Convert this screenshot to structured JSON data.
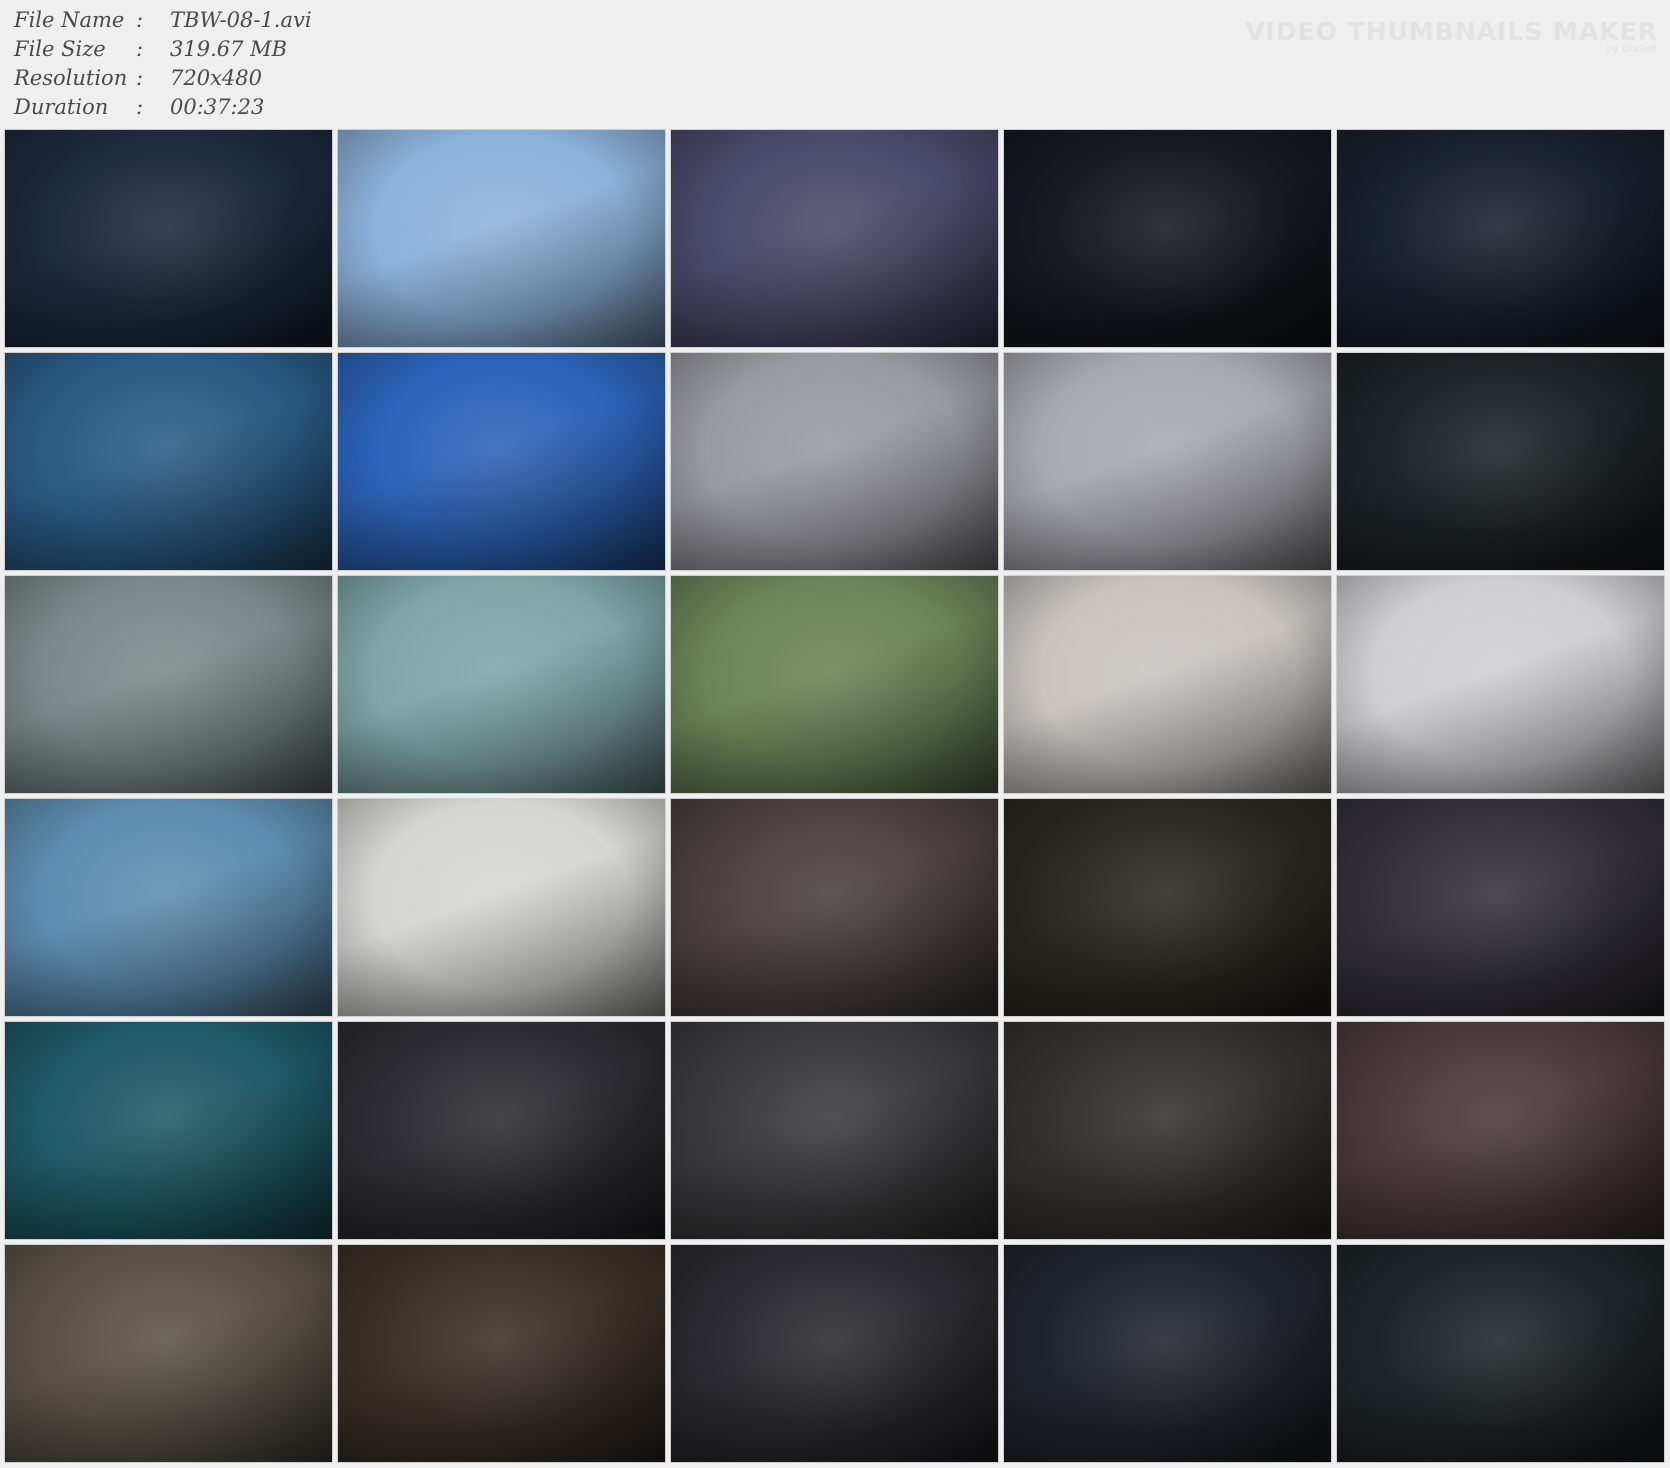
{
  "file_info": {
    "rows": [
      {
        "label": "File Name",
        "value": "TBW-08-1.avi"
      },
      {
        "label": "File Size",
        "value": "319.67 MB"
      },
      {
        "label": "Resolution",
        "value": "720x480"
      },
      {
        "label": "Duration",
        "value": "00:37:23"
      }
    ],
    "separator": ":"
  },
  "watermark": {
    "title": "VIDEO THUMBNAILS MAKER",
    "subtitle": "by DlxSoft"
  },
  "thumbnail_colors": [
    [
      "#1c2a3e",
      "#8cb2da",
      "#4a4a6a",
      "#15181f",
      "#18202c"
    ],
    [
      "#2a5c86",
      "#2c63b8",
      "#9a9aa2",
      "#a8a8b0",
      "#1c2226"
    ],
    [
      "#7a8a8a",
      "#7fa6a8",
      "#6b8458",
      "#c9c4c0",
      "#cfcfd2"
    ],
    [
      "#5d8db0",
      "#d6d6d2",
      "#4a4040",
      "#2a2820",
      "#33303a"
    ],
    [
      "#1e5a66",
      "#2c2c32",
      "#3a3a3c",
      "#34302e",
      "#4a3a3c"
    ],
    [
      "#5a5248",
      "#3a3028",
      "#2a2a30",
      "#20242c",
      "#1e2428"
    ]
  ]
}
